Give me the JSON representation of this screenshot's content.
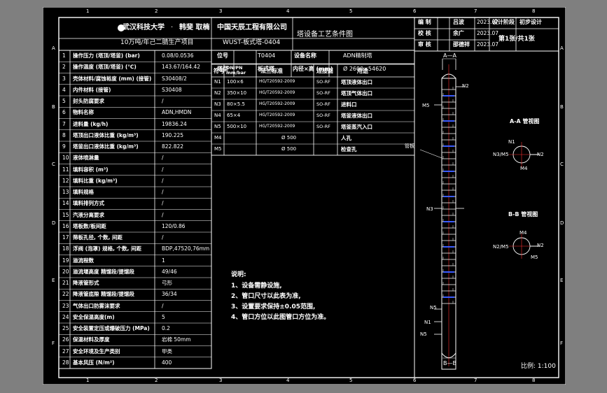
{
  "border_refs": {
    "top": [
      "1",
      "2",
      "3",
      "4",
      "5",
      "6",
      "7",
      "8"
    ],
    "bottom": [
      "1",
      "2",
      "3",
      "4",
      "5",
      "6",
      "7",
      "8"
    ],
    "left": [
      "A",
      "B",
      "C",
      "D",
      "E",
      "F"
    ],
    "right": [
      "A",
      "B",
      "C",
      "D",
      "E",
      "F"
    ]
  },
  "header": {
    "university": "武汉科技大学",
    "sep": "·",
    "authors": "韩斐 取楠",
    "company": "中国天辰工程有限公司",
    "project": "10万吨/年己二腈生产项目",
    "equipment_no": "WUST-板式塔-0404",
    "drawing_title": "塔设备工艺条件图"
  },
  "title_block": {
    "rows": [
      {
        "role": "编  制",
        "name": "吕波",
        "date": "2023.07"
      },
      {
        "role": "校  核",
        "name": "余广",
        "date": "2023.07"
      },
      {
        "role": "审  核",
        "name": "邵德祥",
        "date": "2023.07"
      }
    ],
    "stage_label": "设计阶段",
    "stage_value": "初步设计",
    "sheet_label": "第1张/共1张"
  },
  "params": [
    {
      "no": "1",
      "label": "操作压力 (塔顶/塔釜)  (bar)",
      "value": "0.08/0.0536"
    },
    {
      "no": "2",
      "label": "操作温度 (塔顶/塔釜)  (℃)",
      "value": "143.67/164.42"
    },
    {
      "no": "3",
      "label": "壳体材料/腐蚀裕度 (mm) (接管)",
      "value": "S30408/2"
    },
    {
      "no": "4",
      "label": "内件材料 (接管)",
      "value": "S30408"
    },
    {
      "no": "5",
      "label": "封头防腐要求",
      "value": "/"
    },
    {
      "no": "6",
      "label": "物料名称",
      "value": "ADN,HMDN"
    },
    {
      "no": "7",
      "label": "进料量 (kg/h)",
      "value": "19836.24"
    },
    {
      "no": "8",
      "label": "塔顶出口液体比重 (kg/m³)",
      "value": "190.225"
    },
    {
      "no": "9",
      "label": "塔釜出口液体比重 (kg/m³)",
      "value": "822.822"
    },
    {
      "no": "10",
      "label": "液体喷淋量",
      "value": "/"
    },
    {
      "no": "11",
      "label": "填料容积 (m³)",
      "value": "/"
    },
    {
      "no": "12",
      "label": "填料比重 (kg/m³)",
      "value": "/"
    },
    {
      "no": "13",
      "label": "填料规格",
      "value": "/"
    },
    {
      "no": "14",
      "label": "填料排列方式",
      "value": "/"
    },
    {
      "no": "15",
      "label": "汽液分离要求",
      "value": "/"
    },
    {
      "no": "16",
      "label": "塔板数/板间距",
      "value": "120/0.86"
    },
    {
      "no": "17",
      "label": "筛板孔径, 个数, 间距",
      "value": "/"
    },
    {
      "no": "18",
      "label": "浮阀 (泡罩) 规格, 个数, 间距",
      "value": "BDP,47520,76mm"
    },
    {
      "no": "19",
      "label": "溢流程数",
      "value": "1"
    },
    {
      "no": "20",
      "label": "溢流堰高度 精馏段/提馏段",
      "value": "49/46"
    },
    {
      "no": "21",
      "label": "降液管形式",
      "value": "弓形"
    },
    {
      "no": "22",
      "label": "降液管底隙 精馏段/提馏段",
      "value": "36/34"
    },
    {
      "no": "23",
      "label": "气体出口防雾沫要求",
      "value": "/"
    },
    {
      "no": "24",
      "label": "安全保温高度(m)",
      "value": "5"
    },
    {
      "no": "25",
      "label": "安全装置定压或爆破压力 (MPa)",
      "value": "0.2"
    },
    {
      "no": "26",
      "label": "保温材料及厚度",
      "value": "岩棉 50mm"
    },
    {
      "no": "27",
      "label": "安全环境及生产类别",
      "value": "甲类"
    },
    {
      "no": "28",
      "label": "基本风压 (N/m²)",
      "value": "400"
    }
  ],
  "design_info": {
    "l1": "位号",
    "v1": "T0404",
    "l2": "设备名称",
    "v2": "ADN精制塔",
    "l3": "塔型",
    "v3": "板式塔",
    "l4": "内径×高 (mm)",
    "v4": "Ø 2600×54620"
  },
  "nozzle_table": {
    "headers": [
      "符号",
      "DN/PN mm/bar",
      "法兰标准",
      "连接面",
      "用途"
    ],
    "rows": [
      {
        "sym": "N1",
        "size": "100×6",
        "std": "HG/T20592-2009",
        "face": "SO-RF",
        "use": "塔顶液体出口"
      },
      {
        "sym": "N2",
        "size": "350×10",
        "std": "HG/T20592-2009",
        "face": "SO-RF",
        "use": "塔顶气体出口"
      },
      {
        "sym": "N3",
        "size": "80×5.5",
        "std": "HG/T20592-2009",
        "face": "SO-RF",
        "use": "进料口"
      },
      {
        "sym": "N4",
        "size": "65×4",
        "std": "HG/T20592-2009",
        "face": "SO-RF",
        "use": "塔釜液体出口"
      },
      {
        "sym": "N5",
        "size": "500×10",
        "std": "HG/T20592-2009",
        "face": "SO-RF",
        "use": "塔釜蒸汽入口"
      },
      {
        "sym": "M4",
        "size": "Ø 500",
        "std": "",
        "face": "",
        "use": "人孔"
      },
      {
        "sym": "M5",
        "size": "Ø 500",
        "std": "",
        "face": "",
        "use": "检查孔"
      }
    ]
  },
  "notes": {
    "title": "说明:",
    "items": [
      "1、设备需静设施,",
      "2、管口尺寸以此表为准,",
      "3、设置要求保持±0.05范围,",
      "4、管口方位以此图管口方位为准。"
    ]
  },
  "drawing": {
    "section_aa": "A—A",
    "section_bb": "B—B",
    "view_aa": "A-A 管视图",
    "view_bb": "B-B 管视图",
    "label_plate": "管板",
    "nozzle_labels": [
      "N1",
      "N2",
      "N3",
      "N4",
      "N5",
      "M4",
      "M5",
      "N2/M5",
      "N3/M5"
    ],
    "scale": "比例: 1:100"
  },
  "colors": {
    "frame": "#ffffff",
    "text_yellow": "#ffe64d",
    "text_cyan": "#55e0e0",
    "plates_blue": "#3a5cff",
    "nozzle_red": "#ff3030"
  }
}
